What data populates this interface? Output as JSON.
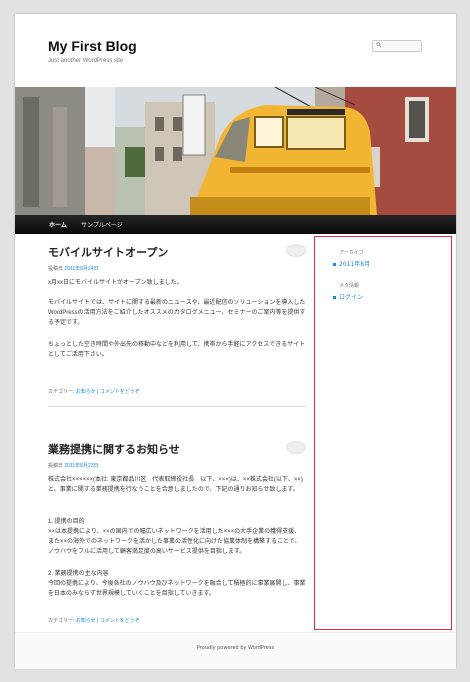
{
  "site": {
    "title": "My First Blog",
    "description": "Just another WordPress site"
  },
  "search": {
    "placeholder": ""
  },
  "nav": {
    "items": [
      {
        "label": "ホーム"
      },
      {
        "label": "サンプルページ"
      }
    ]
  },
  "posts": [
    {
      "title": "モバイルサイトオープン",
      "meta_prefix": "投稿日",
      "date": "2011年8月24日",
      "paragraphs": [
        "x月xx日にモバイルサイトがオープン致しました。",
        "モバイルサイトでは、サイトに関する最新のニュースや、最近配信のソリューションを導入したWordPressの活用方法をご紹介したオススメのカタログメニュー、セミナーのご案内等を提供する予定です。",
        "ちょっとした空き時間や外出先の移動中などを利用して、携帯から手軽にアクセスできるサイトとしてご活用下さい。"
      ],
      "category_prefix": "カテゴリー: ",
      "category": "お知らせ",
      "sep": " | ",
      "comment_link": "コメントをどうぞ"
    },
    {
      "title": "業務提携に関するお知らせ",
      "meta_prefix": "投稿日",
      "date": "2011年8月23日",
      "paragraphs": [
        "株式会社××××××(本社: 東京都品川区　代表取締役社長　以下、×××)は、××株式会社(以下、××)と、事業に関する業務提携を行なうことを合意しましたので、下記の通りお知らせ致します。",
        "1. 提携の目的\n××は本提携により、××の国内での幅広いネットワークを活用した×××の大手企業の獲得支援、また××の海外でのネットワークを活かした事業の活性化に向けた協業体制を構築することで、ノウハウをフルに活用して顧客満足度の高いサービス提供を目指します。",
        "2. 業務提携の主な内容\n今回の提携により、今後各社のノウハウ及びネットワークを融合して積極的に事業展開し、事業を日本のみならず世界規模していくことを目指していきます。"
      ],
      "category_prefix": "カテゴリー: ",
      "category": "お知らせ",
      "sep": " | ",
      "comment_link": "コメントをどうぞ"
    }
  ],
  "sidebar": {
    "archives_title": "アーカイブ",
    "archives": [
      "2011年8月"
    ],
    "meta_title": "メタ情報",
    "meta": [
      "ログイン"
    ]
  },
  "footer": {
    "text": "Proudly powered by WordPress"
  },
  "colors": {
    "accent": "#1b8be0",
    "highlight": "#e0303a",
    "tram": "#f2b632"
  }
}
